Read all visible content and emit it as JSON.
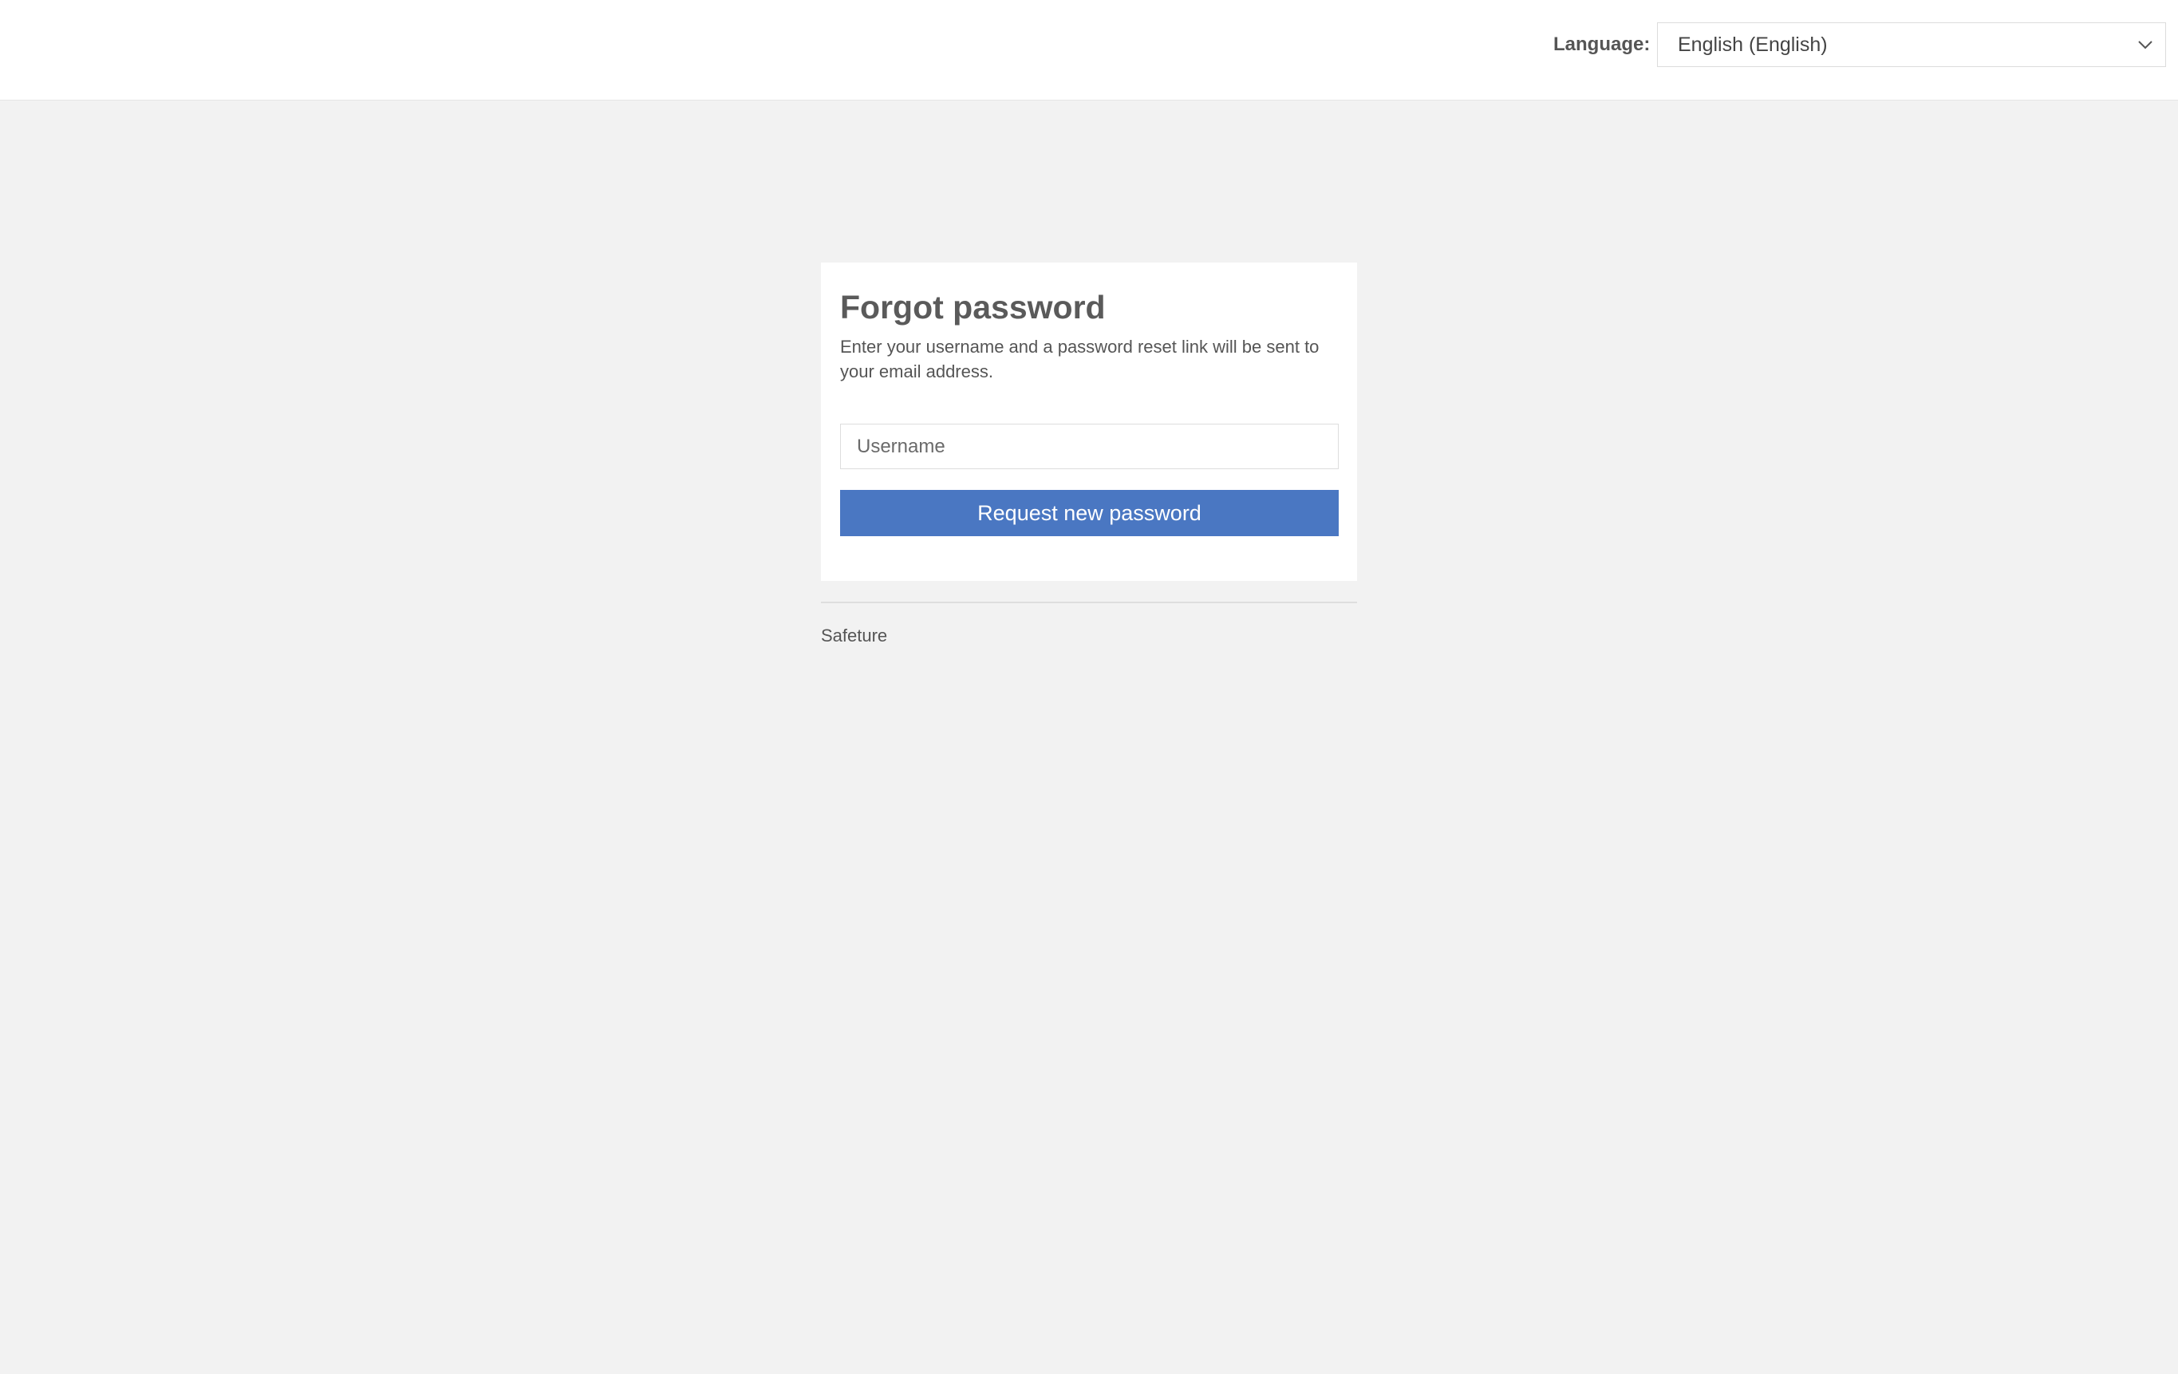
{
  "header": {
    "language_label": "Language:",
    "language_selected": "English (English)",
    "language_icon": "chevron-down-icon"
  },
  "form": {
    "title": "Forgot password",
    "description": "Enter your username and a password reset link will be sent to your email address.",
    "username_value": "",
    "username_placeholder": "Username",
    "submit_label": "Request new password"
  },
  "footer": {
    "brand": "Safeture"
  },
  "colors": {
    "page_background": "#f2f2f2",
    "primary_button": "#4a77c2",
    "text": "#555555"
  }
}
